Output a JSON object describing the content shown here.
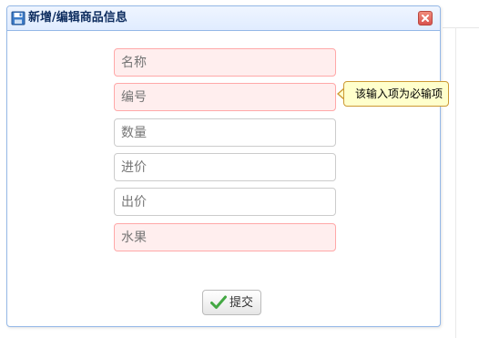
{
  "dialog": {
    "title": "新增/编辑商品信息",
    "icon": "save-disk-icon",
    "close_icon": "close-icon"
  },
  "form": {
    "fields": [
      {
        "name": "name",
        "placeholder": "名称",
        "invalid": true
      },
      {
        "name": "code",
        "placeholder": "编号",
        "invalid": true
      },
      {
        "name": "quantity",
        "placeholder": "数量",
        "invalid": false
      },
      {
        "name": "purchase_price",
        "placeholder": "进价",
        "invalid": false
      },
      {
        "name": "sale_price",
        "placeholder": "出价",
        "invalid": false
      },
      {
        "name": "category",
        "placeholder": "水果",
        "invalid": true
      }
    ],
    "validation_tooltip": "该输入项为必输项",
    "submit_label": "提交",
    "submit_icon": "checkmark-icon"
  },
  "colors": {
    "invalid_bg": "#ffeeee",
    "title_text": "#0e2d5f",
    "panel_border": "#95b8e7",
    "tooltip_bg": "#ffffcc"
  }
}
